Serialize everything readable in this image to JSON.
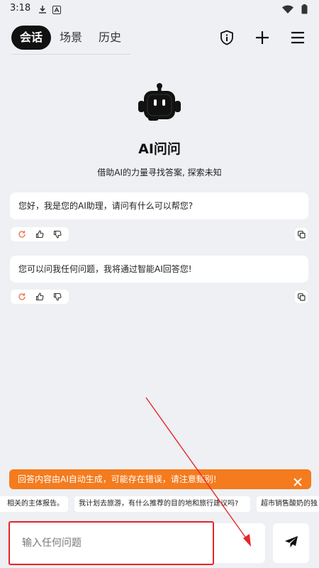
{
  "status_bar": {
    "time": "3:18"
  },
  "header": {
    "tabs": [
      {
        "label": "会话",
        "active": true
      },
      {
        "label": "场景",
        "active": false
      },
      {
        "label": "历史",
        "active": false
      }
    ],
    "icons": [
      "shield-info-icon",
      "plus-icon",
      "menu-icon"
    ]
  },
  "hero": {
    "title": "AI问问",
    "subtitle": "借助AI的力量寻找答案, 探索未知"
  },
  "messages": [
    {
      "text": "您好，我是您的AI助理，请问有什么可以帮您?"
    },
    {
      "text": "您可以问我任何问题，我将通过智能AI回答您!"
    }
  ],
  "warning": {
    "text": "回答内容由AI自动生成，可能存在错误，请注意甄别!"
  },
  "suggestions": [
    "相关的主体报告。",
    "我计划去旅游，有什么推荐的目的地和旅行建议吗?",
    "超市销售酸奶的独"
  ],
  "input": {
    "placeholder": "输入任何问题"
  },
  "colors": {
    "background": "#eef0f3",
    "warning": "#f47b1e",
    "annotation": "#e8262a",
    "active_tab": "#111111"
  }
}
